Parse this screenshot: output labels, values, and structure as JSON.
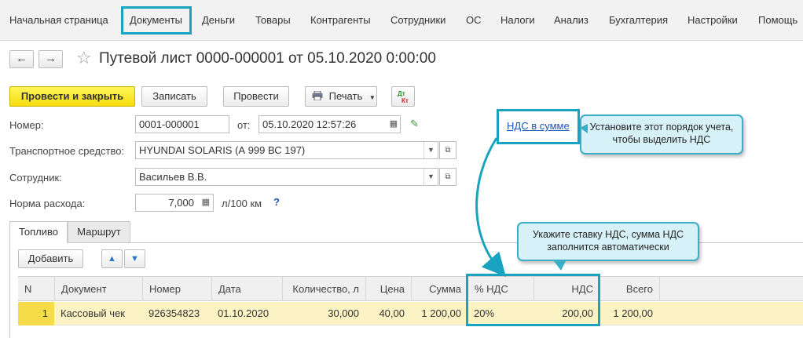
{
  "menu": {
    "items": [
      "Начальная страница",
      "Документы",
      "Деньги",
      "Товары",
      "Контрагенты",
      "Сотрудники",
      "ОС",
      "Налоги",
      "Анализ",
      "Бухгалтерия",
      "Настройки",
      "Помощь"
    ]
  },
  "header": {
    "back_label": "←",
    "forward_label": "→",
    "star": "☆",
    "title": "Путевой лист 0000-000001 от 05.10.2020 0:00:00"
  },
  "toolbar": {
    "post_close_label": "Провести и закрыть",
    "save_label": "Записать",
    "post_label": "Провести",
    "print_label": "Печать",
    "dtkt_top": "Дт",
    "dtkt_bottom": "Кт"
  },
  "form": {
    "number_label": "Номер:",
    "number_value": "0001-000001",
    "date_label": "от:",
    "date_value": "05.10.2020 12:57:26",
    "vat_link": "НДС в сумме",
    "vehicle_label": "Транспортное средство:",
    "vehicle_value": "HYUNDAI SOLARIS (А 999 ВС 197)",
    "employee_label": "Сотрудник:",
    "employee_value": "Васильев В.В.",
    "rate_label": "Норма расхода:",
    "rate_value": "7,000",
    "rate_unit": "л/100 км",
    "help": "?"
  },
  "callouts": {
    "top": "Установите этот порядок учета, чтобы выделить НДС",
    "bottom": "Укажите ставку НДС, сумма НДС заполнится автоматически"
  },
  "tabs": [
    {
      "label": "Топливо",
      "active": true
    },
    {
      "label": "Маршрут",
      "active": false
    }
  ],
  "table_toolbar": {
    "add_label": "Добавить"
  },
  "table": {
    "columns": [
      "N",
      "Документ",
      "Номер",
      "Дата",
      "Количество, л",
      "Цена",
      "Сумма",
      "% НДС",
      "НДС",
      "Всего"
    ],
    "rows": [
      [
        "1",
        "Кассовый чек",
        "926354823",
        "01.10.2020",
        "30,000",
        "40,00",
        "1 200,00",
        "20%",
        "200,00",
        "1 200,00"
      ]
    ]
  },
  "colors": {
    "accent": "#1aa3c0",
    "primary_button": "#f5dc0b",
    "link": "#1c57b8",
    "selected_row": "#fbf3c4"
  }
}
